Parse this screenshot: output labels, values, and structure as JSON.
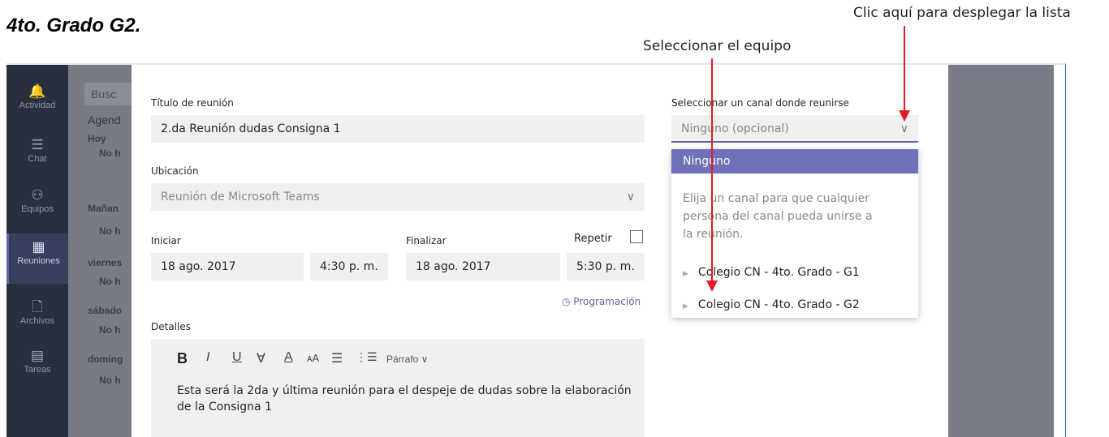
{
  "heading": "4to. Grado G2.",
  "annotations": {
    "expand_list": "Clic aquí para desplegar la lista",
    "select_team": "Seleccionar el equipo",
    "color": "#e31b23"
  },
  "rail": {
    "items": [
      {
        "label": "Actividad",
        "icon": "bell-icon",
        "glyph": "🔔"
      },
      {
        "label": "Chat",
        "icon": "chat-icon",
        "glyph": "☰"
      },
      {
        "label": "Equipos",
        "icon": "teams-icon",
        "glyph": "⚇"
      },
      {
        "label": "Reuniones",
        "icon": "calendar-icon",
        "glyph": "▦"
      },
      {
        "label": "Archivos",
        "icon": "file-icon",
        "glyph": "🗋"
      },
      {
        "label": "Tareas",
        "icon": "tasks-icon",
        "glyph": "▤"
      }
    ],
    "active": "Reuniones"
  },
  "agenda": {
    "search_placeholder": "Busc",
    "title": "Agend",
    "days": [
      {
        "day": "Hoy",
        "status": "No h"
      },
      {
        "day": "Mañan",
        "status": "No h"
      },
      {
        "day": "viernes",
        "status": "No h"
      },
      {
        "day": "sábado",
        "status": "No h"
      },
      {
        "day": "doming",
        "status": "No h"
      }
    ]
  },
  "form": {
    "title_label": "Título de reunión",
    "title_value": "2.da Reunión dudas Consigna 1",
    "location_label": "Ubicación",
    "location_value": "Reunión de Microsoft Teams",
    "start_label": "Iniciar",
    "start_date": "18 ago. 2017",
    "start_time": "4:30 p. m.",
    "end_label": "Finalizar",
    "end_date": "18 ago. 2017",
    "end_time": "5:30 p. m.",
    "repeat_label": "Repetir",
    "schedule_link": "Programación",
    "details_label": "Detalles",
    "toolbar": {
      "bold": "B",
      "italic": "I",
      "underline": "U",
      "strike": "∀",
      "color": "A",
      "size": "ᴀA",
      "bullets": "☰",
      "numbers": "⋮☰",
      "paragraph": "Párrafo ∨"
    },
    "details_text": "Esta será la 2da y última reunión para el despeje de dudas sobre la elaboración de la Consigna 1"
  },
  "channel": {
    "label": "Seleccionar un canal donde reunirse",
    "placeholder": "Ninguno (opcional)",
    "selected_option": "Ninguno",
    "help_text": "Elija un canal para que cualquier persona del canal pueda unirse a la reunión.",
    "options": [
      "Colegio CN - 4to. Grado - G1",
      "Colegio CN - 4to. Grado - G2"
    ]
  }
}
